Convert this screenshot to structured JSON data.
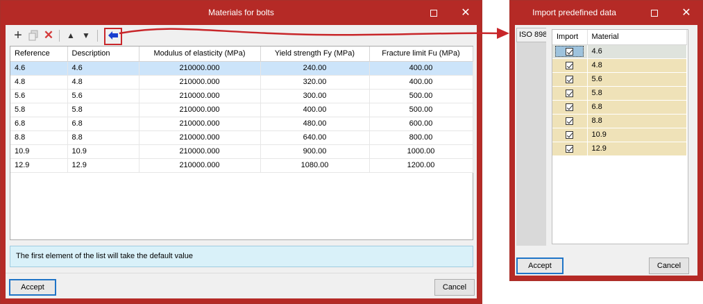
{
  "main_dialog": {
    "title": "Materials for bolts",
    "toolbar": {
      "icons": [
        "add-icon",
        "copy-icon",
        "delete-icon",
        "move-up-icon",
        "move-down-icon",
        "import-arrow-icon"
      ],
      "add_glyph": "+",
      "delete_glyph": "✕",
      "up_glyph": "▲",
      "down_glyph": "▼",
      "import_glyph": "⇦"
    },
    "columns": [
      "Reference",
      "Description",
      "Modulus of elasticity (MPa)",
      "Yield strength Fy (MPa)",
      "Fracture limit Fu (MPa)"
    ],
    "rows": [
      [
        "4.6",
        "4.6",
        "210000.000",
        "240.00",
        "400.00"
      ],
      [
        "4.8",
        "4.8",
        "210000.000",
        "320.00",
        "400.00"
      ],
      [
        "5.6",
        "5.6",
        "210000.000",
        "300.00",
        "500.00"
      ],
      [
        "5.8",
        "5.8",
        "210000.000",
        "400.00",
        "500.00"
      ],
      [
        "6.8",
        "6.8",
        "210000.000",
        "480.00",
        "600.00"
      ],
      [
        "8.8",
        "8.8",
        "210000.000",
        "640.00",
        "800.00"
      ],
      [
        "10.9",
        "10.9",
        "210000.000",
        "900.00",
        "1000.00"
      ],
      [
        "12.9",
        "12.9",
        "210000.000",
        "1080.00",
        "1200.00"
      ]
    ],
    "selected_row": 0,
    "info_message": "The first element of the list will take the default value",
    "accept_label": "Accept",
    "cancel_label": "Cancel"
  },
  "import_dialog": {
    "title": "Import predefined data",
    "tab_label": "ISO 898",
    "columns": [
      "Import",
      "Material"
    ],
    "materials": [
      "4.6",
      "4.8",
      "5.6",
      "5.8",
      "6.8",
      "8.8",
      "10.9",
      "12.9"
    ],
    "accept_label": "Accept",
    "cancel_label": "Cancel"
  },
  "window_controls": {
    "maximize": "□",
    "close": "✕"
  },
  "colors": {
    "frame": "#b52a26",
    "highlight": "#c8262a",
    "selection": "#cce4fa",
    "info_bg": "#d9f1f9",
    "import_row_bg": "#efe2b8",
    "primary_button_border": "#1f74c7"
  }
}
